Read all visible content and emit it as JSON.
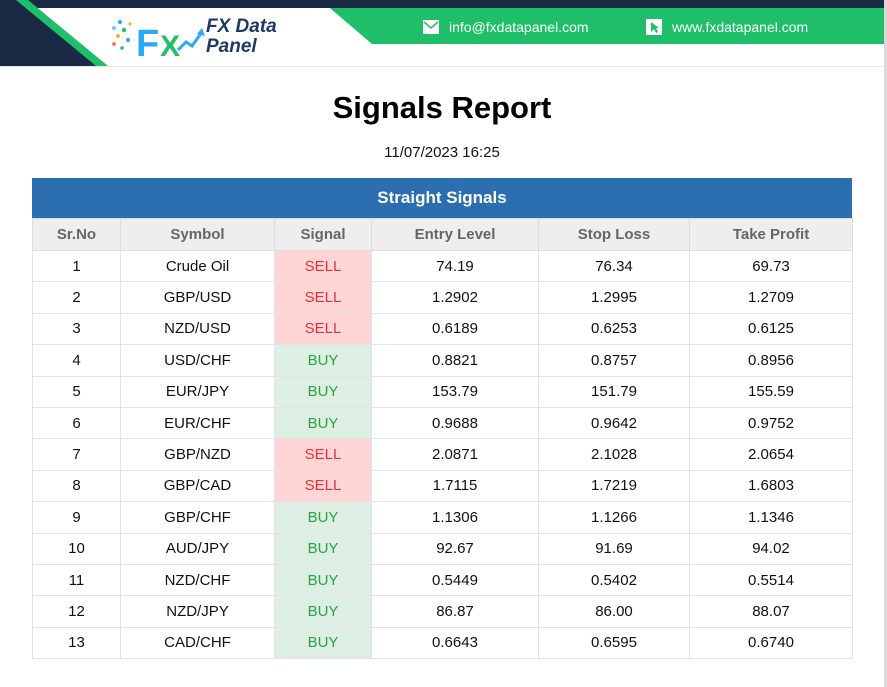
{
  "header": {
    "logo_line1": "FX Data",
    "logo_line2": "Panel",
    "email": "info@fxdatapanel.com",
    "website": "www.fxdatapanel.com",
    "colors": {
      "green": "#1fbf6a",
      "navy": "#1b2a44",
      "logo_text": "#1e3a63"
    }
  },
  "report": {
    "title": "Signals Report",
    "datetime": "11/07/2023 16:25"
  },
  "table": {
    "banner": "Straight Signals",
    "banner_color": "#2b6fb0",
    "columns": [
      "Sr.No",
      "Symbol",
      "Signal",
      "Entry Level",
      "Stop Loss",
      "Take Profit"
    ],
    "rows": [
      [
        "1",
        "Crude Oil",
        "SELL",
        "74.19",
        "76.34",
        "69.73"
      ],
      [
        "2",
        "GBP/USD",
        "SELL",
        "1.2902",
        "1.2995",
        "1.2709"
      ],
      [
        "3",
        "NZD/USD",
        "SELL",
        "0.6189",
        "0.6253",
        "0.6125"
      ],
      [
        "4",
        "USD/CHF",
        "BUY",
        "0.8821",
        "0.8757",
        "0.8956"
      ],
      [
        "5",
        "EUR/JPY",
        "BUY",
        "153.79",
        "151.79",
        "155.59"
      ],
      [
        "6",
        "EUR/CHF",
        "BUY",
        "0.9688",
        "0.9642",
        "0.9752"
      ],
      [
        "7",
        "GBP/NZD",
        "SELL",
        "2.0871",
        "2.1028",
        "2.0654"
      ],
      [
        "8",
        "GBP/CAD",
        "SELL",
        "1.7115",
        "1.7219",
        "1.6803"
      ],
      [
        "9",
        "GBP/CHF",
        "BUY",
        "1.1306",
        "1.1266",
        "1.1346"
      ],
      [
        "10",
        "AUD/JPY",
        "BUY",
        "92.67",
        "91.69",
        "94.02"
      ],
      [
        "11",
        "NZD/CHF",
        "BUY",
        "0.5449",
        "0.5402",
        "0.5514"
      ],
      [
        "12",
        "NZD/JPY",
        "BUY",
        "86.87",
        "86.00",
        "88.07"
      ],
      [
        "13",
        "CAD/CHF",
        "BUY",
        "0.6643",
        "0.6595",
        "0.6740"
      ]
    ],
    "signal_colors": {
      "SELL": {
        "bg": "#ffd5d5",
        "fg": "#e0343a"
      },
      "BUY": {
        "bg": "#dcefe2",
        "fg": "#2fa04a"
      }
    }
  }
}
